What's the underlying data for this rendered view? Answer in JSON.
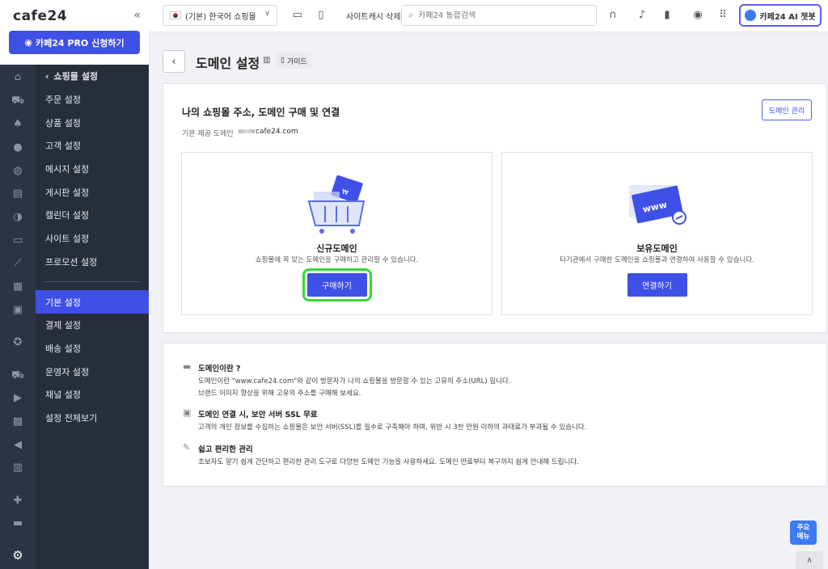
{
  "sidebar": {
    "logo": "cafe24",
    "pro_button": "카페24 PRO 신청하기",
    "menu_header": "쇼핑몰 설정",
    "menu_top": [
      "주문 설정",
      "상품 설정",
      "고객 설정",
      "메시지 설정",
      "게시판 설정",
      "캘린더 설정",
      "사이트 설정",
      "프로모션 설정"
    ],
    "menu_bottom": [
      "기본 설정",
      "결제 설정",
      "배송 설정",
      "운영자 설정",
      "채널 설정",
      "설정 전체보기"
    ],
    "active_item": "기본 설정"
  },
  "topbar": {
    "shop_select": "(기본) 한국어 쇼핑몰",
    "cache_delete": "사이트캐시 삭제",
    "search_placeholder": "카페24 통합검색",
    "ai_chatbot": "카페24 AI 챗봇"
  },
  "page": {
    "title": "도메인 설정",
    "guide": "가이드"
  },
  "domain_section": {
    "title": "나의 쇼핑몰 주소, 도메인 구매 및 연결",
    "manage_button": "도메인 관리",
    "base_label": "기본 제공 도메인",
    "base_value": "cafe24.com",
    "new_domain": {
      "title": "신규도메인",
      "desc": "쇼핑몰에 꼭 맞는 도메인을 구매하고 관리할 수 있습니다.",
      "button": "구매하기"
    },
    "own_domain": {
      "title": "보유도메인",
      "desc": "타기관에서 구매한 도메인을 쇼핑몰과 연결하여 사용할 수 있습니다.",
      "button": "연결하기",
      "art_text": "www"
    }
  },
  "info_section": {
    "items": [
      {
        "icon": "card-icon",
        "title": "도메인이란 ?",
        "lines": [
          "도메인이란 \"www.cafe24.com\"와 같이 방문자가 나의 쇼핑몰을 방문할 수 있는 고유의 주소(URL) 입니다.",
          "브랜드 이미지 향상을 위해 고유의 주소를 구매해 보세요."
        ]
      },
      {
        "icon": "lock-icon",
        "title": "도메인 연결 시, 보안 서버 SSL 무료",
        "lines": [
          "고객의 개인 정보를 수집하는 쇼핑몰은 보안 서버(SSL)를 필수로 구축해야 하며, 위반 시 3천 만원 이하의 과태료가 부과될 수 있습니다."
        ]
      },
      {
        "icon": "wrench-icon",
        "title": "쉽고 편리한 관리",
        "lines": [
          "초보자도 알기 쉽게 간단하고 편리한 관리 도구로 다양한 도메인 기능을 사용하세요. 도메인 만료부터 복구까지 쉽게 안내해 드립니다."
        ]
      }
    ]
  },
  "floating": {
    "quick_menu_line1": "주요",
    "quick_menu_line2": "메뉴"
  },
  "colors": {
    "accent": "#3f50e6",
    "sidebar_bg": "#262d3b",
    "highlight": "#38d838"
  }
}
